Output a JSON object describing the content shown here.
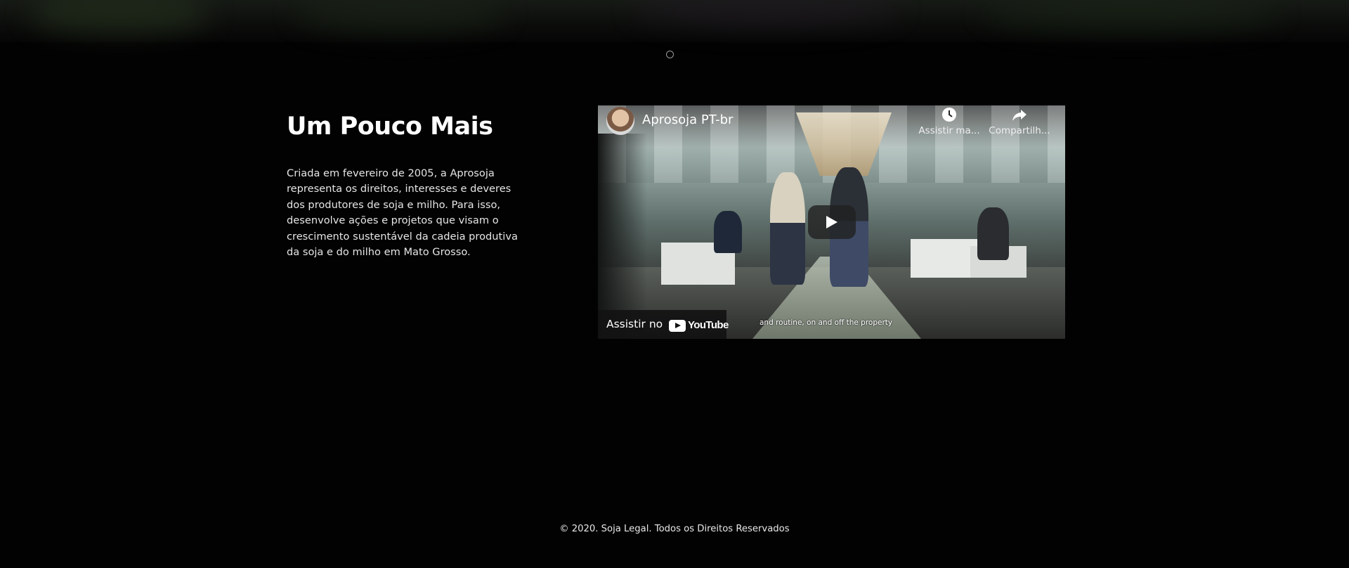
{
  "about": {
    "title": "Um Pouco Mais",
    "text": "Criada em fevereiro de 2005, a Aprosoja representa os direitos, interesses e deveres dos produtores de soja e milho. Para isso, desenvolve ações e projetos que visam o crescimento sustentável da cadeia produtiva da soja e do milho em Mato Grosso."
  },
  "video": {
    "channel": "Aprosoja PT-br",
    "watch_later": "Assistir ma...",
    "share": "Compartilh...",
    "subtitle": "and routine, on and off the property",
    "watch_on": "Assistir no",
    "youtube_logo": "YouTube"
  },
  "footer": {
    "copyright": "© 2020. Soja Legal. Todos os Direitos Reservados"
  },
  "icons": {
    "slider_dot": "circle-outline",
    "watch_later": "clock-icon",
    "share": "share-arrow-icon",
    "play": "play-icon"
  },
  "colors": {
    "background": "#020202",
    "text": "#ffffff",
    "player_bar": "#121212"
  }
}
